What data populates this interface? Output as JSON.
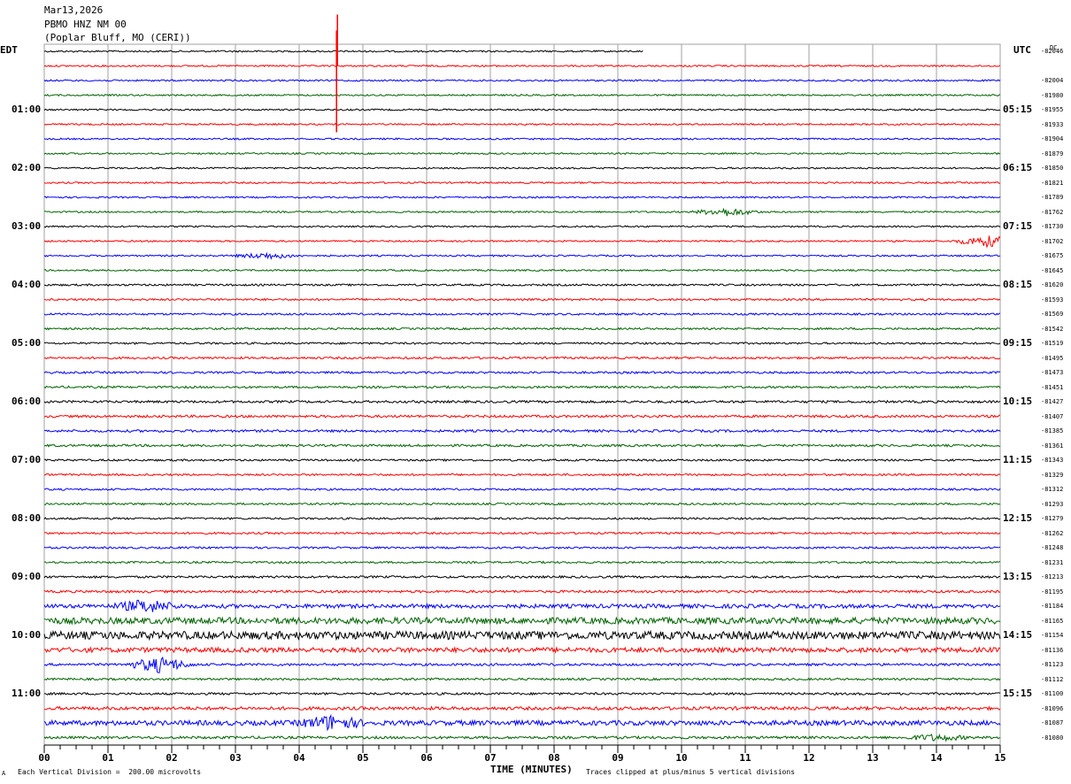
{
  "header": {
    "date": "Mar13,2026",
    "station": "PBMO HNZ NM 00",
    "location": "(Poplar Bluff, MO (CERI))"
  },
  "left_zone": "EDT",
  "right_zone": "UTC",
  "dc_label": "DC",
  "footer": {
    "scale": "Each Vertical Division =  200.00 microvolts",
    "clip": "Traces clipped at plus/minus 5 vertical divisions",
    "corner_mark": "A"
  },
  "colors": {
    "trace_cycle": [
      "#000000",
      "#ff0000",
      "#0000ff",
      "#006400"
    ],
    "grid": "#a0a0a0"
  },
  "chart_data": {
    "type": "line",
    "title": "",
    "xlabel": "TIME (MINUTES)",
    "xlim": [
      0,
      15
    ],
    "x_ticks": [
      "00",
      "01",
      "02",
      "03",
      "04",
      "05",
      "06",
      "07",
      "08",
      "09",
      "10",
      "11",
      "12",
      "13",
      "14",
      "15"
    ],
    "rows": 48,
    "minutes_per_row": 15,
    "left_hour_labels": [
      "01:00",
      "02:00",
      "03:00",
      "04:00",
      "05:00",
      "06:00",
      "07:00",
      "08:00",
      "09:00",
      "10:00",
      "11:00"
    ],
    "right_hour_labels": [
      "05:15",
      "06:15",
      "07:15",
      "08:15",
      "09:15",
      "10:15",
      "11:15",
      "12:15",
      "13:15",
      "14:15",
      "15:15"
    ],
    "hour_label_rows": [
      4,
      8,
      12,
      16,
      20,
      24,
      28,
      32,
      36,
      40,
      44
    ],
    "dc_offsets": [
      "-82046",
      "-82004",
      "-81980",
      "-81955",
      "-81933",
      "-81904",
      "-81879",
      "-81850",
      "-81821",
      "-81789",
      "-81762",
      "-81730",
      "-81702",
      "-81675",
      "-81645",
      "-81620",
      "-81593",
      "-81569",
      "-81542",
      "-81519",
      "-81495",
      "-81473",
      "-81451",
      "-81427",
      "-81407",
      "-81385",
      "-81361",
      "-81343",
      "-81329",
      "-81312",
      "-81293",
      "-81279",
      "-81262",
      "-81248",
      "-81231",
      "-81213",
      "-81195",
      "-81184",
      "-81165",
      "-81154",
      "-81136",
      "-81123",
      "-81112",
      "-81100",
      "-81096",
      "-81087",
      "-81080"
    ],
    "noise_level": [
      1,
      1,
      1,
      1,
      1,
      1,
      1,
      1,
      1,
      1,
      1,
      1,
      1,
      1,
      1,
      1,
      1.2,
      1.2,
      1.2,
      1.2,
      1.2,
      1.3,
      1.3,
      1.3,
      1.5,
      1.5,
      1.5,
      1.4,
      1.2,
      1.2,
      1.2,
      1.2,
      1.2,
      1.2,
      1.2,
      1.2,
      1.4,
      1.5,
      2.5,
      4,
      5,
      3,
      1.5,
      1.3,
      1.4,
      2,
      3,
      1.6
    ],
    "events": [
      {
        "row": 1,
        "minute": 4.6,
        "type": "step spike",
        "note": "large red spike clipped at top"
      },
      {
        "row": 11,
        "minute": 10.7,
        "amplitude": 4
      },
      {
        "row": 13,
        "minute": 14.8,
        "amplitude": 6
      },
      {
        "row": 14,
        "minute": 3.5,
        "amplitude": 3
      },
      {
        "row": 38,
        "minute": 1.6,
        "amplitude": 6
      },
      {
        "row": 42,
        "minute": 1.8,
        "amplitude": 8
      },
      {
        "row": 46,
        "minute": 4.5,
        "amplitude": 7
      },
      {
        "row": 47,
        "minute": 14.0,
        "amplitude": 3
      }
    ],
    "last_row_end_minute": 9.4
  }
}
